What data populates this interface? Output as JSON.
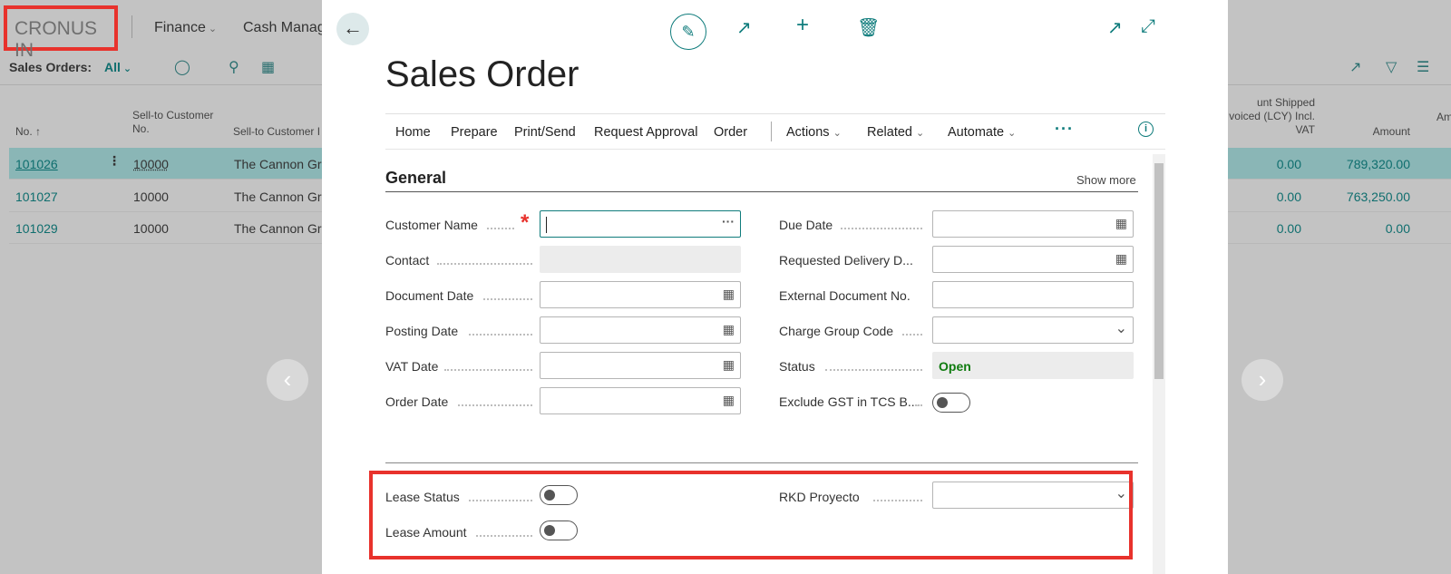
{
  "background": {
    "company": "CRONUS IN",
    "nav": {
      "finance": "Finance",
      "cash": "Cash Manag"
    },
    "toolbar": {
      "label": "Sales Orders:",
      "filter": "All"
    },
    "columns": {
      "no": "No. ↑",
      "sell_to_no": "Sell-to Customer No.",
      "sell_to_name": "Sell-to Customer I",
      "amt_shipped": "unt Shipped voiced (LCY) Incl. VAT",
      "amount": "Amount",
      "am2": "Am"
    },
    "rows": [
      {
        "no": "101026",
        "cust_no": "10000",
        "cust_name": "The Cannon Gr",
        "shipped": "0.00",
        "amount": "789,320.00"
      },
      {
        "no": "101027",
        "cust_no": "10000",
        "cust_name": "The Cannon Gr",
        "shipped": "0.00",
        "amount": "763,250.00"
      },
      {
        "no": "101029",
        "cust_no": "10000",
        "cust_name": "The Cannon Gr",
        "shipped": "0.00",
        "amount": "0.00"
      }
    ]
  },
  "modal": {
    "title": "Sales Order",
    "actions": {
      "home": "Home",
      "prepare": "Prepare",
      "print_send": "Print/Send",
      "request_approval": "Request Approval",
      "order": "Order",
      "actions": "Actions",
      "related": "Related",
      "automate": "Automate"
    },
    "section": {
      "title": "General",
      "show_more": "Show more"
    },
    "fields": {
      "customer_name": "Customer Name",
      "contact": "Contact",
      "document_date": "Document Date",
      "posting_date": "Posting Date",
      "vat_date": "VAT Date",
      "order_date": "Order Date",
      "due_date": "Due Date",
      "requested_delivery": "Requested Delivery D...",
      "external_doc": "External Document No.",
      "charge_group": "Charge Group Code",
      "status": "Status",
      "status_value": "Open",
      "exclude_gst": "Exclude GST in TCS B...",
      "lease_status": "Lease Status",
      "lease_amount": "Lease Amount",
      "rkd_proyecto": "RKD Proyecto"
    }
  }
}
